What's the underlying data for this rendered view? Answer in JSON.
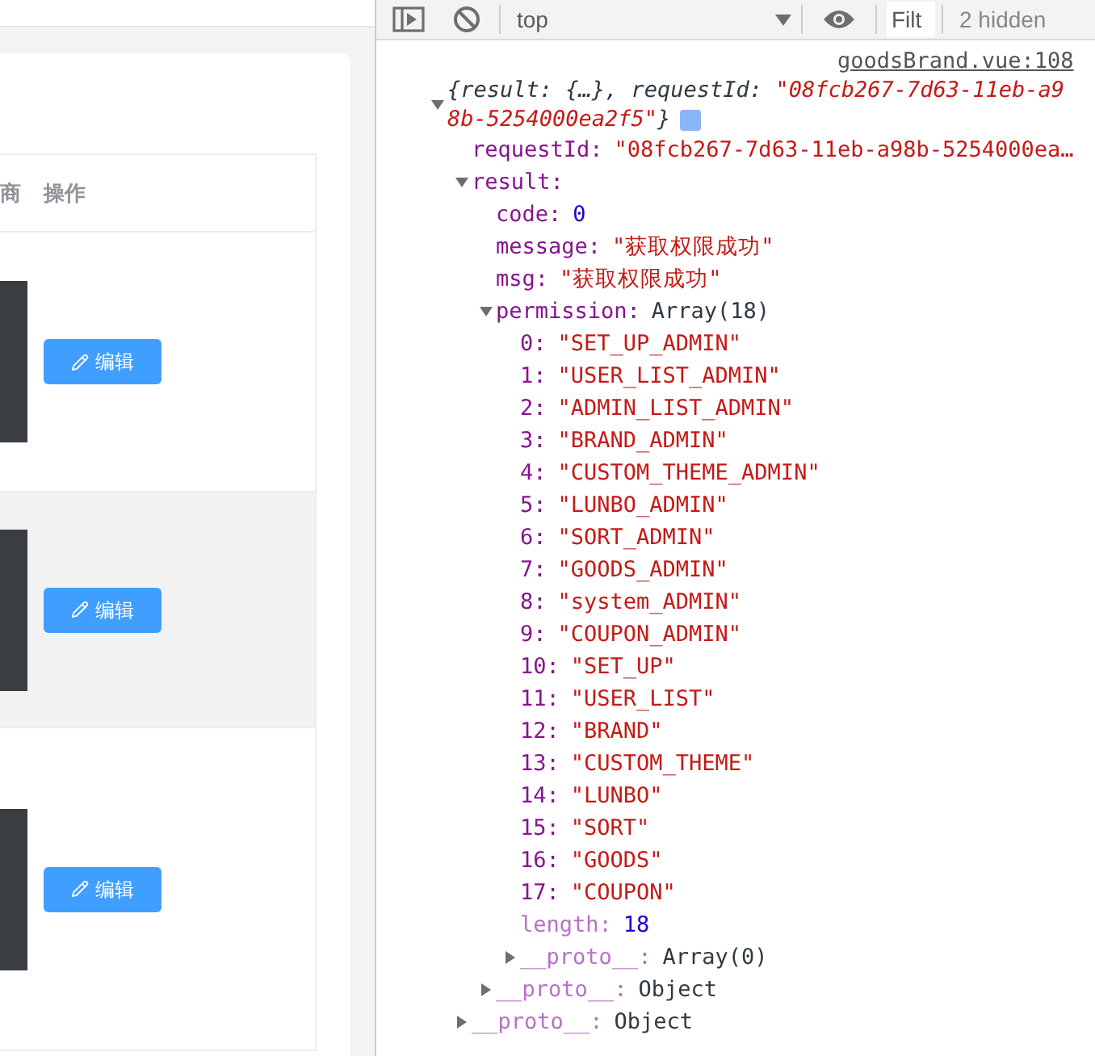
{
  "table": {
    "columns": [
      {
        "label": "商"
      },
      {
        "label": "操作"
      }
    ],
    "rows": [
      {
        "button": "编辑",
        "shaded": false
      },
      {
        "button": "编辑",
        "shaded": true
      },
      {
        "button": "编辑",
        "shaded": false
      }
    ]
  },
  "devtools": {
    "toolbar": {
      "context": "top",
      "filter_placeholder": "Filt",
      "hidden_count": "2 hidden"
    },
    "console": {
      "source": "goodsBrand.vue:108",
      "expanded": true,
      "summary": [
        [
          {
            "text": "{result: {…}, requestId: ",
            "kind": "plain"
          },
          {
            "text": "\"08fcb267-7d63-11eb-a9",
            "kind": "string"
          }
        ],
        [
          {
            "text": "8b-5254000ea2f5\"",
            "kind": "string"
          },
          {
            "text": "}",
            "kind": "plain"
          }
        ]
      ],
      "children": [
        {
          "key": "requestId:",
          "kind": "string",
          "value": "\"08fcb267-7d63-11eb-a98b-5254000ea…"
        },
        {
          "key": "result:",
          "expanded": true,
          "children": [
            {
              "key": "code:",
              "kind": "number",
              "value": "0"
            },
            {
              "key": "message:",
              "kind": "string",
              "value": "\"获取权限成功\""
            },
            {
              "key": "msg:",
              "kind": "string",
              "value": "\"获取权限成功\""
            },
            {
              "key": "permission:",
              "kind": "object",
              "value": "Array(18)",
              "expanded": true,
              "children": [
                {
                  "key": "0:",
                  "kind": "string",
                  "value": "\"SET_UP_ADMIN\""
                },
                {
                  "key": "1:",
                  "kind": "string",
                  "value": "\"USER_LIST_ADMIN\""
                },
                {
                  "key": "2:",
                  "kind": "string",
                  "value": "\"ADMIN_LIST_ADMIN\""
                },
                {
                  "key": "3:",
                  "kind": "string",
                  "value": "\"BRAND_ADMIN\""
                },
                {
                  "key": "4:",
                  "kind": "string",
                  "value": "\"CUSTOM_THEME_ADMIN\""
                },
                {
                  "key": "5:",
                  "kind": "string",
                  "value": "\"LUNBO_ADMIN\""
                },
                {
                  "key": "6:",
                  "kind": "string",
                  "value": "\"SORT_ADMIN\""
                },
                {
                  "key": "7:",
                  "kind": "string",
                  "value": "\"GOODS_ADMIN\""
                },
                {
                  "key": "8:",
                  "kind": "string",
                  "value": "\"system_ADMIN\""
                },
                {
                  "key": "9:",
                  "kind": "string",
                  "value": "\"COUPON_ADMIN\""
                },
                {
                  "key": "10:",
                  "kind": "string",
                  "value": "\"SET_UP\""
                },
                {
                  "key": "11:",
                  "kind": "string",
                  "value": "\"USER_LIST\""
                },
                {
                  "key": "12:",
                  "kind": "string",
                  "value": "\"BRAND\""
                },
                {
                  "key": "13:",
                  "kind": "string",
                  "value": "\"CUSTOM_THEME\""
                },
                {
                  "key": "14:",
                  "kind": "string",
                  "value": "\"LUNBO\""
                },
                {
                  "key": "15:",
                  "kind": "string",
                  "value": "\"SORT\""
                },
                {
                  "key": "16:",
                  "kind": "string",
                  "value": "\"GOODS\""
                },
                {
                  "key": "17:",
                  "kind": "string",
                  "value": "\"COUPON\""
                },
                {
                  "key": "length:",
                  "kind": "number",
                  "value": "18",
                  "dim": true
                },
                {
                  "key": "__proto__:",
                  "kind": "object",
                  "value": "Array(0)",
                  "dim": true,
                  "expanded": false
                }
              ]
            },
            {
              "key": "__proto__:",
              "kind": "object",
              "value": "Object",
              "dim": true,
              "expanded": false
            }
          ]
        },
        {
          "key": "__proto__:",
          "kind": "object",
          "value": "Object",
          "dim": true,
          "expanded": false
        }
      ]
    }
  }
}
